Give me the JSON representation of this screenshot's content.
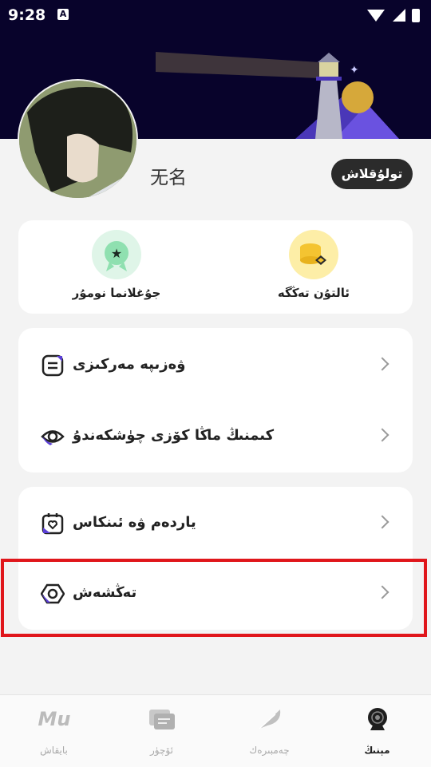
{
  "status_bar": {
    "time": "9:28",
    "notif_badge": "A"
  },
  "profile": {
    "username": "无名",
    "login_label": "تولۇقلاش"
  },
  "quick_actions": [
    {
      "label": "جۇغلانما نومۇر",
      "icon": "award-badge-icon"
    },
    {
      "label": "ئالتۇن تەڭگە",
      "icon": "gold-coins-icon"
    }
  ],
  "menu_group_1": [
    {
      "label": "ۋەزىپە مەركىزى",
      "icon": "task-list-icon"
    },
    {
      "label": "كىمنىڭ ماڭا كۆزى چۈشكەندۇ",
      "icon": "eye-icon"
    }
  ],
  "menu_group_2": [
    {
      "label": "ياردەم ۋە ئىنكاس",
      "icon": "help-heart-icon"
    },
    {
      "label": "تەڭشەش",
      "icon": "settings-hex-icon"
    }
  ],
  "tabbar": [
    {
      "label": "بايقاش",
      "icon": "mu-logo-icon"
    },
    {
      "label": "ئۆچۈر",
      "icon": "messages-icon"
    },
    {
      "label": "چەمبىرەك",
      "icon": "feather-icon"
    },
    {
      "label": "مېنىڭ",
      "icon": "profile-cam-icon",
      "active": true
    }
  ],
  "colors": {
    "header_bg": "#08032b",
    "accent": "#5b3fd6",
    "highlight": "#e0161b"
  }
}
